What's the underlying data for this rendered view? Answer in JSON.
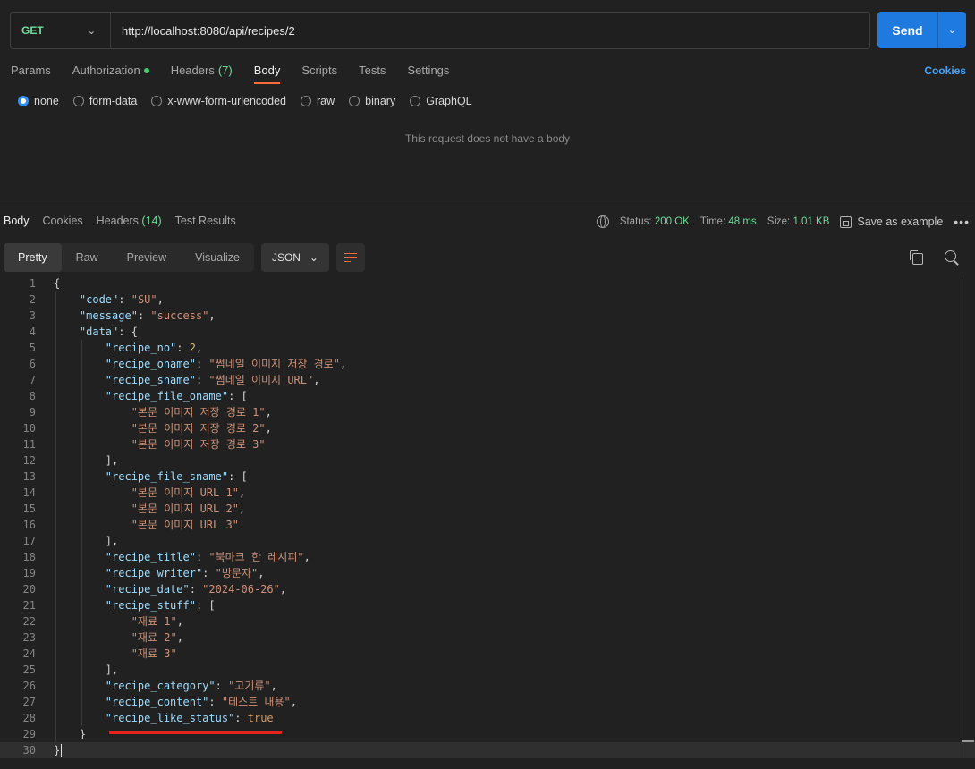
{
  "request": {
    "method": "GET",
    "url": "http://localhost:8080/api/recipes/2",
    "send_label": "Send",
    "tabs": [
      {
        "label": "Params"
      },
      {
        "label": "Authorization"
      },
      {
        "label": "Headers",
        "count": "(7)"
      },
      {
        "label": "Body"
      },
      {
        "label": "Scripts"
      },
      {
        "label": "Tests"
      },
      {
        "label": "Settings"
      }
    ],
    "active_tab": "Body",
    "cookies_label": "Cookies",
    "body_types": [
      "none",
      "form-data",
      "x-www-form-urlencoded",
      "raw",
      "binary",
      "GraphQL"
    ],
    "selected_body_type": "none",
    "empty_message": "This request does not have a body"
  },
  "response": {
    "tabs": [
      {
        "label": "Body"
      },
      {
        "label": "Cookies"
      },
      {
        "label": "Headers",
        "count": "(14)"
      },
      {
        "label": "Test Results"
      }
    ],
    "status_label": "Status:",
    "status_value": "200 OK",
    "time_label": "Time:",
    "time_value": "48 ms",
    "size_label": "Size:",
    "size_value": "1.01 KB",
    "save_example_label": "Save as example",
    "views": [
      "Pretty",
      "Raw",
      "Preview",
      "Visualize"
    ],
    "active_view": "Pretty",
    "format": "JSON",
    "code_lines": [
      "{",
      "    \"code\": \"SU\",",
      "    \"message\": \"success\",",
      "    \"data\": {",
      "        \"recipe_no\": 2,",
      "        \"recipe_oname\": \"썸네일 이미지 저장 경로\",",
      "        \"recipe_sname\": \"썸네일 이미지 URL\",",
      "        \"recipe_file_oname\": [",
      "            \"본문 이미지 저장 경로 1\",",
      "            \"본문 이미지 저장 경로 2\",",
      "            \"본문 이미지 저장 경로 3\"",
      "        ],",
      "        \"recipe_file_sname\": [",
      "            \"본문 이미지 URL 1\",",
      "            \"본문 이미지 URL 2\",",
      "            \"본문 이미지 URL 3\"",
      "        ],",
      "        \"recipe_title\": \"북마크 한 레시피\",",
      "        \"recipe_writer\": \"방문자\",",
      "        \"recipe_date\": \"2024-06-26\",",
      "        \"recipe_stuff\": [",
      "            \"재료 1\",",
      "            \"재료 2\",",
      "            \"재료 3\"",
      "        ],",
      "        \"recipe_category\": \"고기류\",",
      "        \"recipe_content\": \"테스트 내용\",",
      "        \"recipe_like_status\": true",
      "    }",
      "}"
    ]
  },
  "colors": {
    "accent": "#1f7ae0",
    "tab_underline": "#ff6c37",
    "status_green": "#6bdd9a",
    "annotation_underline": "#e8231a"
  },
  "icons": [
    "chevron-down-icon",
    "globe-icon",
    "save-icon",
    "more-icon",
    "wrap-icon",
    "copy-icon",
    "search-icon"
  ]
}
